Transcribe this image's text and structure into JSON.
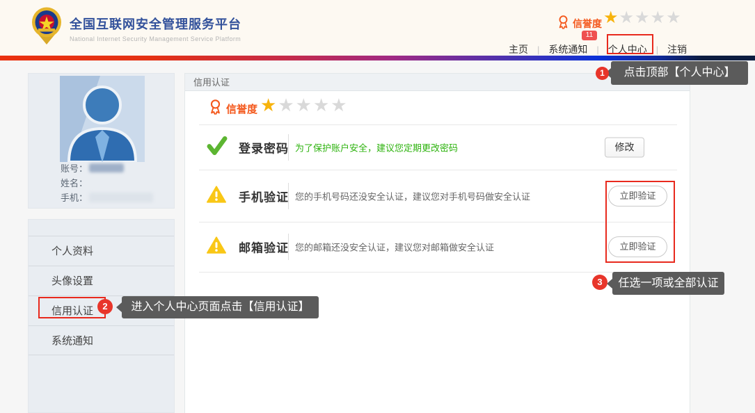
{
  "header": {
    "title": "全国互联网安全管理服务平台",
    "subtitle": "National Internet Security Management Service Platform",
    "reputation_label": "信誉度",
    "notification_count": "11",
    "nav": [
      {
        "label": "主页"
      },
      {
        "label": "系统通知"
      },
      {
        "label": "个人中心"
      },
      {
        "label": "注销"
      }
    ]
  },
  "rating": {
    "filled": 1,
    "total": 5
  },
  "sidebar": {
    "profile": {
      "account_label": "账号：",
      "name_label": "姓名：",
      "phone_label": "手机："
    },
    "menu": [
      {
        "label": "个人资料"
      },
      {
        "label": "头像设置"
      },
      {
        "label": "信用认证"
      },
      {
        "label": "系统通知"
      }
    ]
  },
  "main": {
    "panel_title": "信用认证",
    "reputation_label": "信誉度",
    "rows": [
      {
        "status": "ok",
        "label": "登录密码",
        "desc": "为了保护账户安全，建议您定期更改密码",
        "action": "修改"
      },
      {
        "status": "warning",
        "label": "手机验证",
        "desc": "您的手机号码还没安全认证，建议您对手机号码做安全认证",
        "action": "立即验证"
      },
      {
        "status": "warning",
        "label": "邮箱验证",
        "desc": "您的邮箱还没安全认证，建议您对邮箱做安全认证",
        "action": "立即验证"
      }
    ]
  },
  "annotations": [
    {
      "step": "1",
      "text": "点击顶部【个人中心】"
    },
    {
      "step": "2",
      "text": "进入个人中心页面点击【信用认证】"
    },
    {
      "step": "3",
      "text": "任选一项或全部认证"
    }
  ],
  "colors": {
    "accent_red": "#e8291d",
    "orange": "#f4581c",
    "gold_star": "#f7b30c",
    "gray_star": "#d9d9d9",
    "green": "#2eb30f",
    "warning_yellow": "#f9c716",
    "gradient_bar": [
      "#ea3110",
      "#a02a84",
      "#0d32d8",
      "#0d1d40"
    ]
  }
}
